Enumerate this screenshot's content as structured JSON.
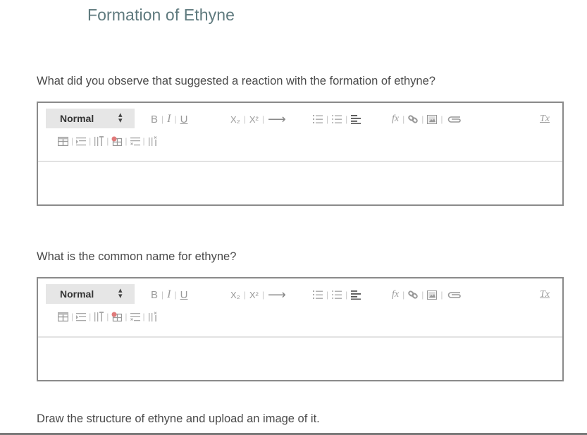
{
  "page": {
    "title": "Formation of Ethyne"
  },
  "questions": [
    {
      "text": "What did you observe that suggested a reaction with the formation of ethyne?",
      "editor": {
        "format_select": "Normal",
        "body_value": ""
      }
    },
    {
      "text": "What is the common name for ethyne?",
      "editor": {
        "format_select": "Normal",
        "body_value": ""
      }
    },
    {
      "text": "Draw the structure of ethyne and upload an image of it."
    }
  ],
  "toolbar": {
    "bold": "B",
    "italic": "I",
    "underline": "U",
    "subscript": "X₂",
    "superscript": "X²",
    "arrow": "⟶",
    "formula": "fx",
    "clear_format": "Tx",
    "icons_row1": [
      "bold-icon",
      "italic-icon",
      "underline-icon",
      "subscript-icon",
      "superscript-icon",
      "arrow-icon",
      "ordered-list-icon",
      "unordered-list-icon",
      "align-icon",
      "formula-icon",
      "link-icon",
      "image-icon",
      "attachment-icon",
      "clear-format-icon"
    ],
    "icons_row2": [
      "insert-table-icon",
      "insert-row-icon",
      "insert-column-icon",
      "delete-table-icon",
      "delete-row-icon",
      "delete-column-icon"
    ]
  }
}
